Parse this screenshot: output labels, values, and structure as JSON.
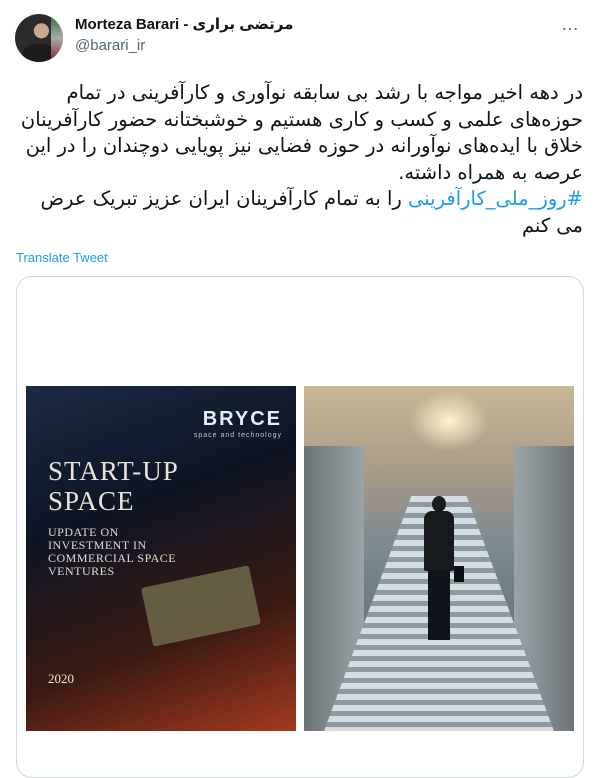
{
  "author": {
    "display_name": "Morteza Barari - مرتضی براری",
    "handle": "@barari_ir"
  },
  "menu": {
    "more_icon": "…"
  },
  "tweet": {
    "text": "در دهه اخیر مواجه با رشد بی سابقه نوآوری و کارآفرینی در تمام حوزه‌های علمی و کسب و کاری هستیم و خوشبختانه حضور کارآفرینان خلاق با ایده‌های نوآورانه در حوزه فضایی نیز پویایی دوچندان را در این عرصه به همراه داشته.",
    "hashtag": "#روز_ملی_کارآفرینی",
    "hashtag_color": "#1d9bf0",
    "closing": "را به تمام کارآفرینان ایران عزیز تبریک عرض می کنم"
  },
  "translate_label": "Translate Tweet",
  "media": {
    "image1": {
      "brand": "BRYCE",
      "brand_tagline": "space and technology",
      "title_line1": "START-UP",
      "title_line2": "SPACE",
      "subtitle": "UPDATE ON INVESTMENT IN COMMERCIAL SPACE VENTURES",
      "year": "2020"
    },
    "image2": {
      "description_icon": "stairs-businessman-photo"
    }
  }
}
